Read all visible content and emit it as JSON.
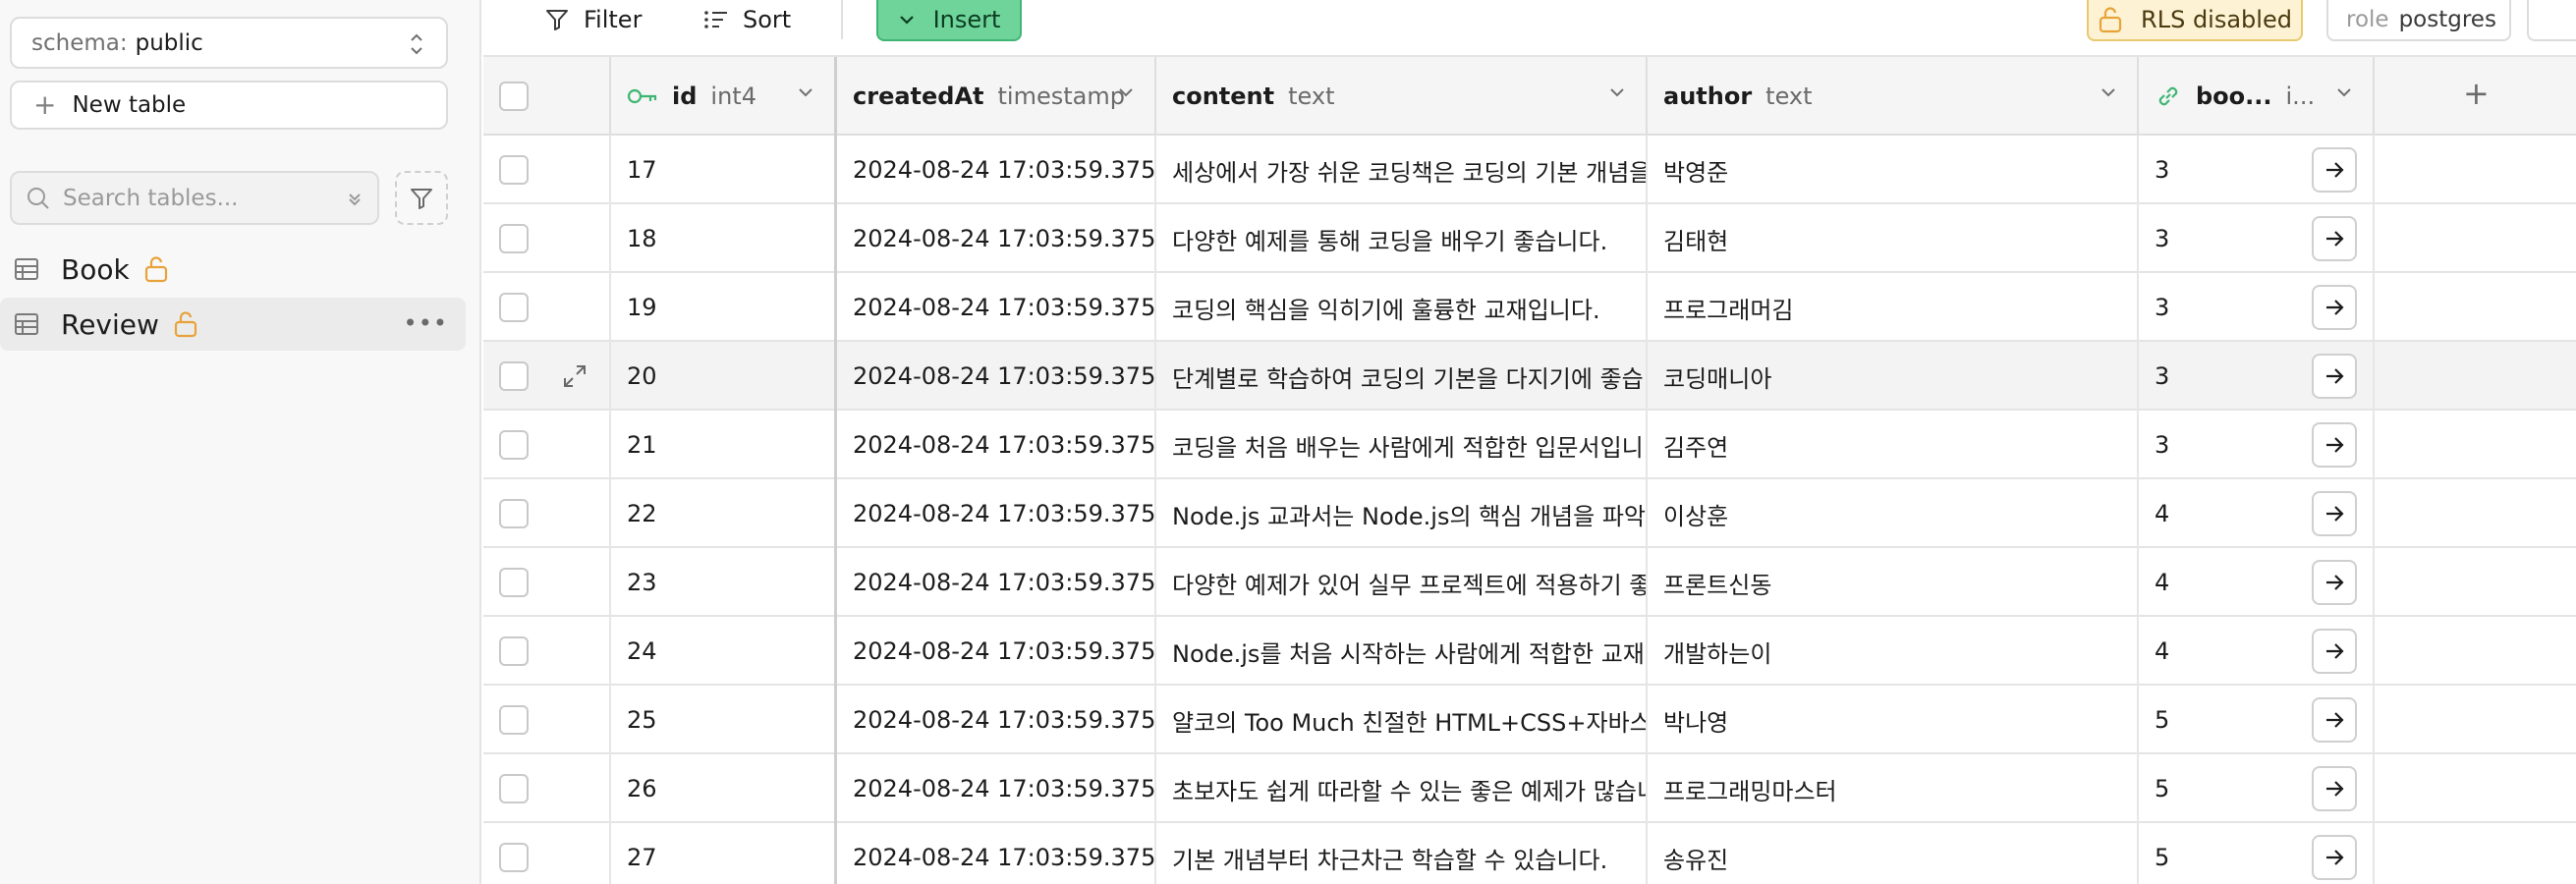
{
  "sidebar": {
    "schema_label": "schema:",
    "schema_value": "public",
    "new_table_label": "New table",
    "search_placeholder": "Search tables...",
    "tables": [
      {
        "name": "Book",
        "active": false
      },
      {
        "name": "Review",
        "active": true
      }
    ]
  },
  "toolbar": {
    "filter_label": "Filter",
    "sort_label": "Sort",
    "insert_label": "Insert",
    "rls_label": "RLS disabled",
    "role_label": "role",
    "role_value": "postgres"
  },
  "grid": {
    "columns": [
      {
        "name": "id",
        "type": "int4"
      },
      {
        "name": "createdAt",
        "type": "timestamp"
      },
      {
        "name": "content",
        "type": "text"
      },
      {
        "name": "author",
        "type": "text"
      },
      {
        "name": "boo...",
        "type": "i..."
      }
    ],
    "add_column_label": "+",
    "rows": [
      {
        "id": "17",
        "createdAt": "2024-08-24 17:03:59.375",
        "content": "세상에서 가장 쉬운 코딩책은 코딩의 기본 개념을",
        "author": "박영준",
        "book": "3"
      },
      {
        "id": "18",
        "createdAt": "2024-08-24 17:03:59.375",
        "content": "다양한 예제를 통해 코딩을 배우기 좋습니다.",
        "author": "김태현",
        "book": "3"
      },
      {
        "id": "19",
        "createdAt": "2024-08-24 17:03:59.375",
        "content": "코딩의 핵심을 익히기에 훌륭한 교재입니다.",
        "author": "프로그래머김",
        "book": "3"
      },
      {
        "id": "20",
        "createdAt": "2024-08-24 17:03:59.375",
        "content": "단계별로 학습하여 코딩의 기본을 다지기에 좋습",
        "author": "코딩매니아",
        "book": "3"
      },
      {
        "id": "21",
        "createdAt": "2024-08-24 17:03:59.375",
        "content": "코딩을 처음 배우는 사람에게 적합한 입문서입니",
        "author": "김주연",
        "book": "3"
      },
      {
        "id": "22",
        "createdAt": "2024-08-24 17:03:59.375",
        "content": "Node.js 교과서는 Node.js의 핵심 개념을 파악",
        "author": "이상훈",
        "book": "4"
      },
      {
        "id": "23",
        "createdAt": "2024-08-24 17:03:59.375",
        "content": "다양한 예제가 있어 실무 프로젝트에 적용하기 좋",
        "author": "프론트신동",
        "book": "4"
      },
      {
        "id": "24",
        "createdAt": "2024-08-24 17:03:59.375",
        "content": "Node.js를 처음 시작하는 사람에게 적합한 교재",
        "author": "개발하는이",
        "book": "4"
      },
      {
        "id": "25",
        "createdAt": "2024-08-24 17:03:59.375",
        "content": "얄코의 Too Much 친절한 HTML+CSS+자바스",
        "author": "박나영",
        "book": "5"
      },
      {
        "id": "26",
        "createdAt": "2024-08-24 17:03:59.375",
        "content": "초보자도 쉽게 따라할 수 있는 좋은 예제가 많습니",
        "author": "프로그래밍마스터",
        "book": "5"
      },
      {
        "id": "27",
        "createdAt": "2024-08-24 17:03:59.375",
        "content": "기본 개념부터 차근차근 학습할 수 있습니다.",
        "author": "송유진",
        "book": "5"
      }
    ]
  },
  "colors": {
    "insert_bg": "#6fd49a",
    "rls_bg": "#fdf3d4",
    "lock_orange": "#e8a23a",
    "key_green": "#3fb574"
  }
}
